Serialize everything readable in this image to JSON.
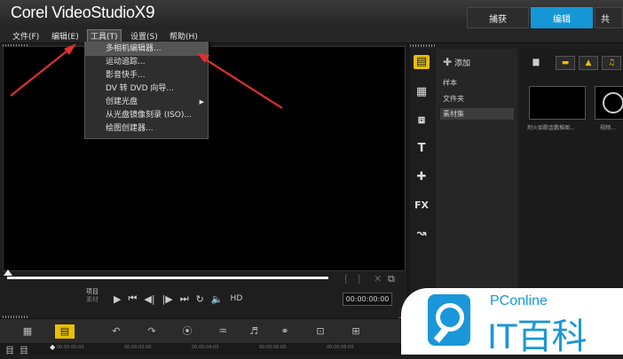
{
  "app": {
    "logo": "Corel VideoStudio",
    "logo_version": "X9"
  },
  "tabs": [
    {
      "label": "捕获"
    },
    {
      "label": "编辑"
    },
    {
      "label": "共"
    }
  ],
  "menubar": [
    {
      "label": "文件(F)"
    },
    {
      "label": "编辑(E)"
    },
    {
      "label": "工具(T)"
    },
    {
      "label": "设置(S)"
    },
    {
      "label": "帮助(H)"
    }
  ],
  "tools_menu": [
    {
      "label": "多相机编辑器..."
    },
    {
      "label": "运动追踪..."
    },
    {
      "label": "影音快手..."
    },
    {
      "label": "DV 转 DVD 向导..."
    },
    {
      "label": "创建光盘"
    },
    {
      "label": "从光盘镜像刻录 (ISO)..."
    },
    {
      "label": "绘图创建器..."
    }
  ],
  "player": {
    "project_label": "项目",
    "clip_label": "素材",
    "hd_label": "HD",
    "timecode": "00:00:00:00"
  },
  "library": {
    "add_label": "添加",
    "folders": [
      {
        "label": "样本"
      },
      {
        "label": "文件夹"
      },
      {
        "label": "素材集"
      }
    ],
    "thumbs": [
      {
        "label": "烈火如歌金鹏推图..."
      },
      {
        "label": "视频..."
      }
    ]
  },
  "ruler": {
    "ticks": [
      "00:00:00:00",
      "00:00:02:00",
      "00:00:04:00",
      "00:00:06:00",
      "00:00:08:00"
    ]
  },
  "watermark": {
    "top": "PConline",
    "main": "IT百科"
  },
  "colors": {
    "accent": "#1596d6",
    "highlight": "#e8c000",
    "arrow": "#e03030"
  }
}
